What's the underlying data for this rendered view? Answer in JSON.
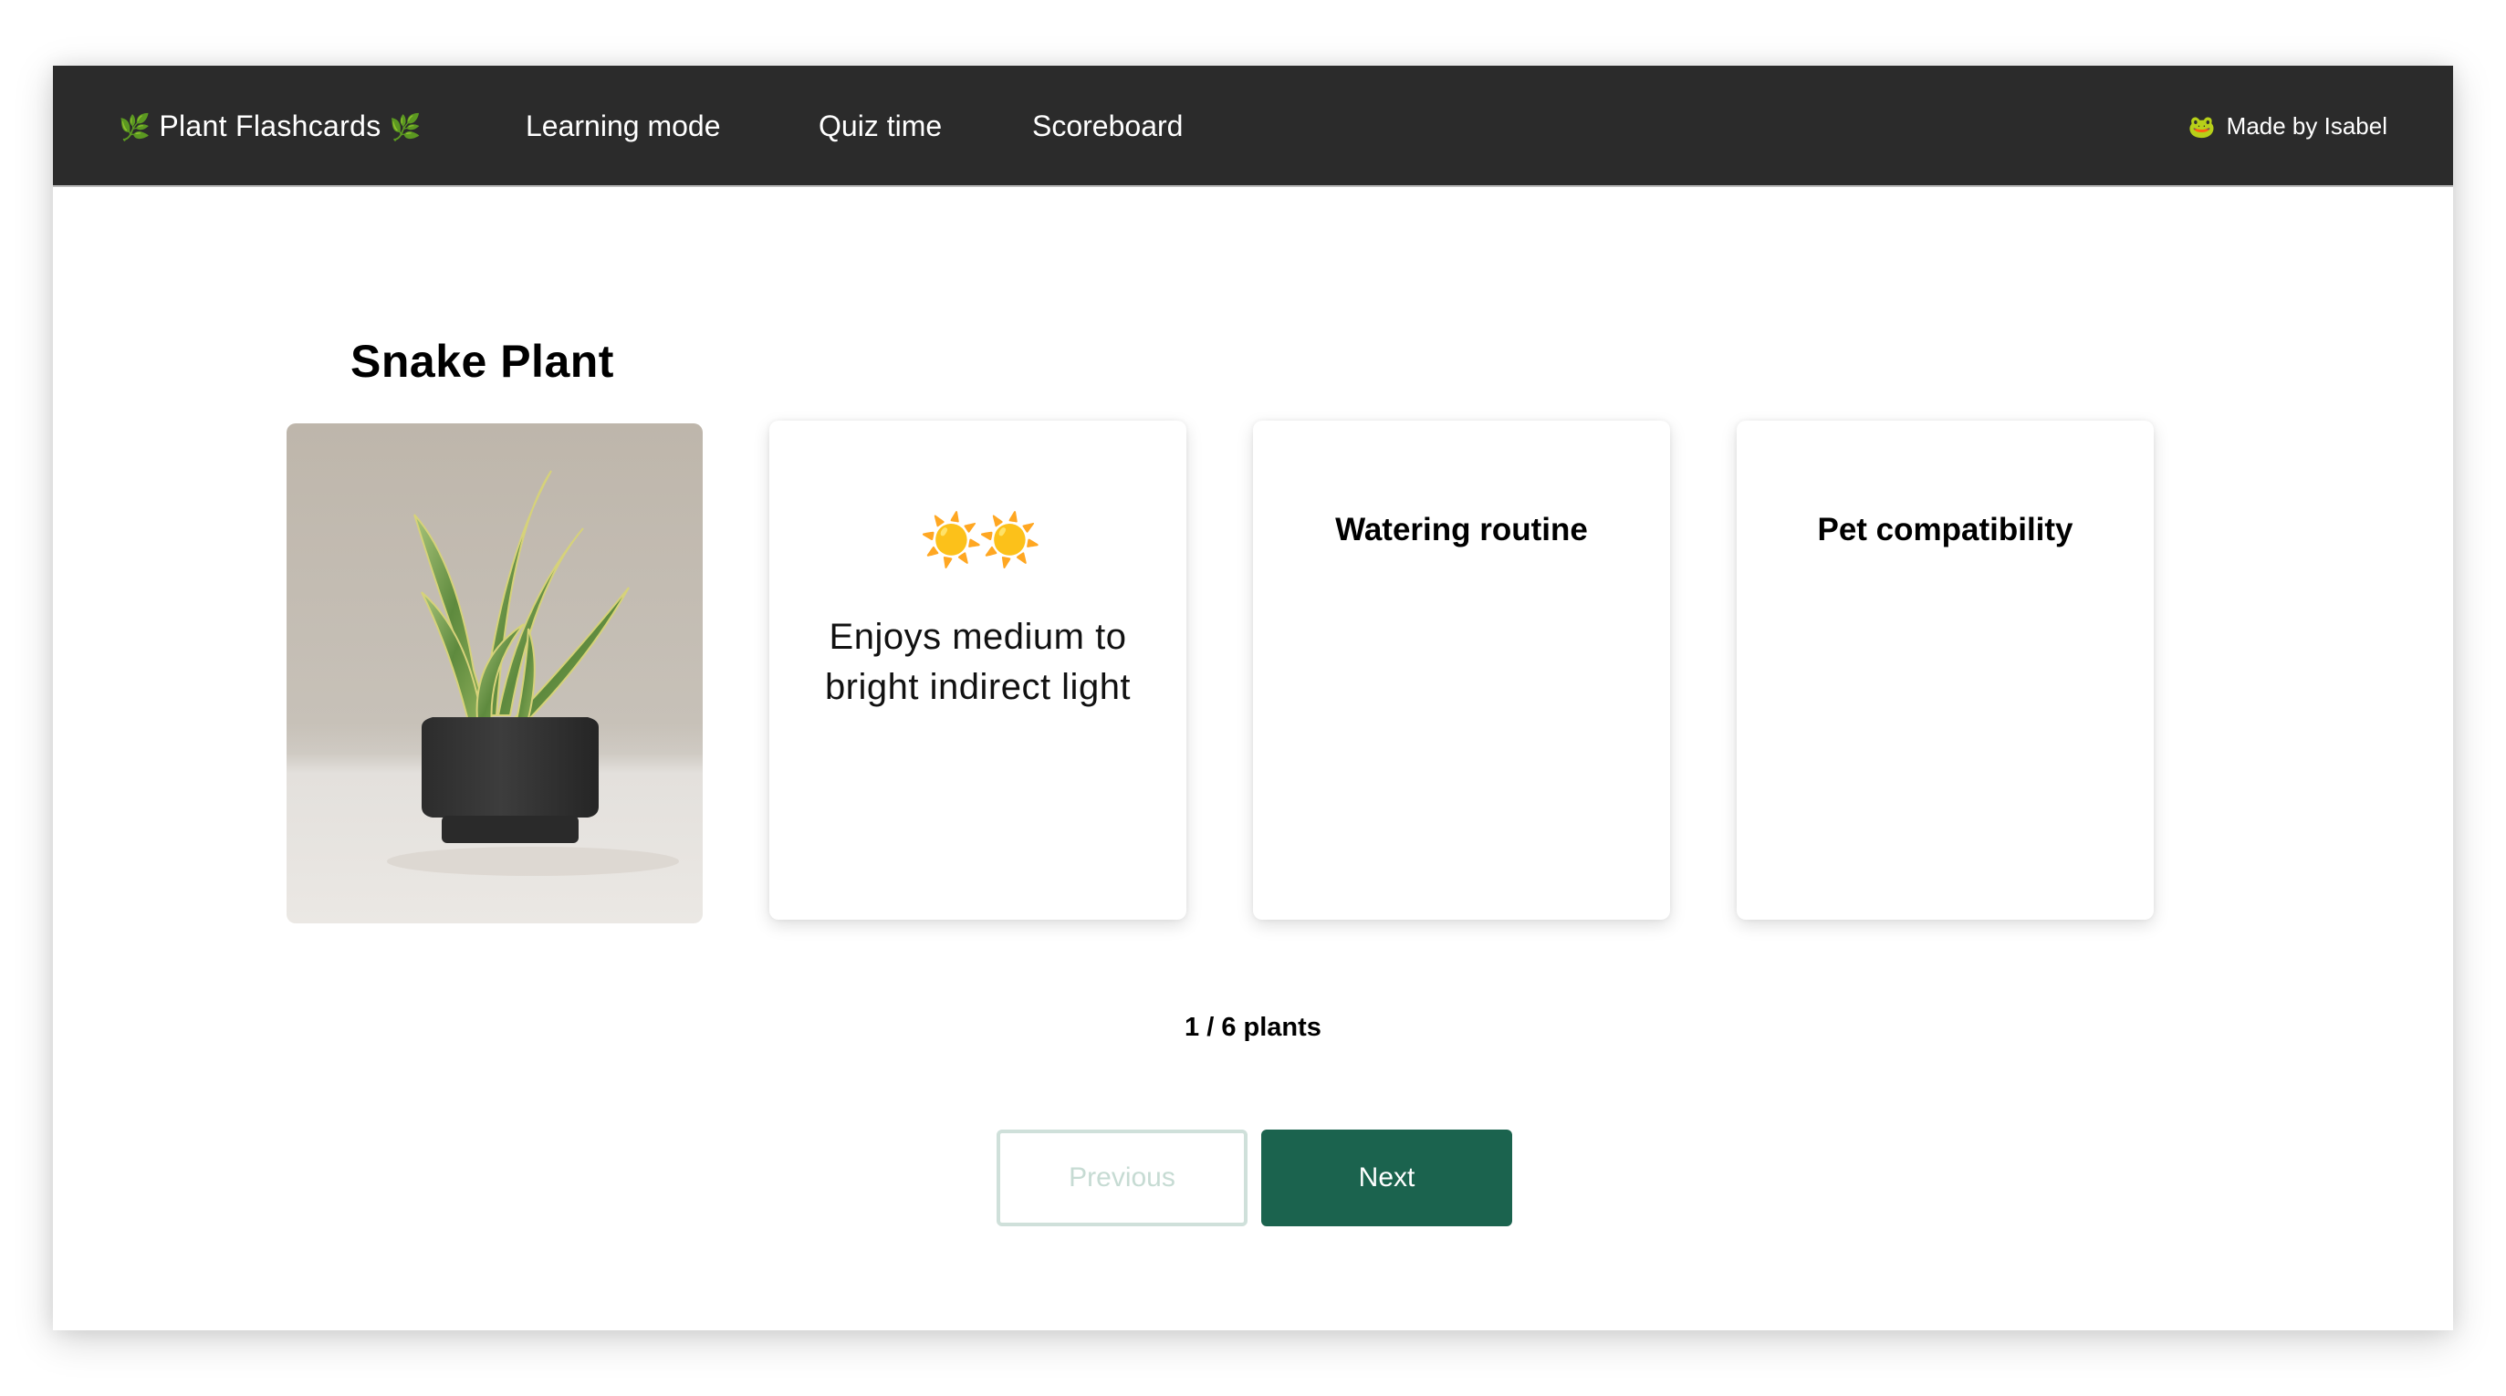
{
  "navbar": {
    "brand": {
      "icon_left": "🌿",
      "label": "Plant Flashcards",
      "icon_right": "🌿",
      "icon_name": "herb-icon"
    },
    "links": [
      {
        "label": "Learning mode"
      },
      {
        "label": "Quiz time"
      },
      {
        "label": "Scoreboard"
      }
    ],
    "made_by": {
      "icon": "🐸",
      "icon_name": "frog-icon",
      "label": "Made by Isabel"
    }
  },
  "plant": {
    "name": "Snake Plant",
    "image_alt": "Snake plant in a black pot"
  },
  "cards": {
    "light": {
      "icons": "☀️☀️",
      "icon_name": "sun-icon",
      "sun_count": 2,
      "description": "Enjoys medium to bright indirect light"
    },
    "water": {
      "heading": "Watering routine"
    },
    "pet": {
      "heading": "Pet compatibility"
    }
  },
  "progress": {
    "current": 1,
    "total": 6,
    "label": "1 / 6 plants"
  },
  "buttons": {
    "previous": "Previous",
    "next": "Next"
  },
  "colors": {
    "navbar_bg": "#2b2b2b",
    "primary": "#1b634e",
    "disabled_border": "#cfe0da",
    "disabled_text": "#c6dbd3"
  }
}
